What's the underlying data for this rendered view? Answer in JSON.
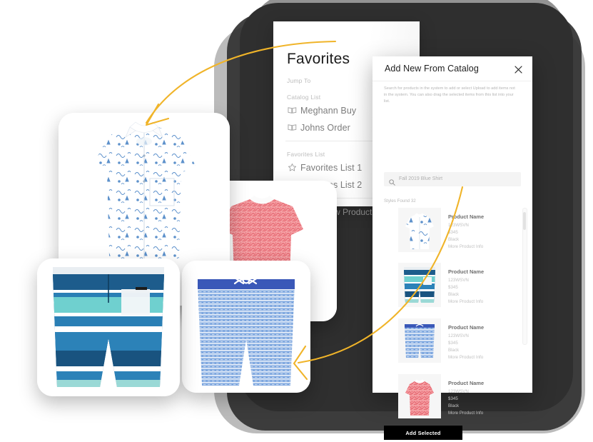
{
  "favorites_panel": {
    "title": "Favorites",
    "chevron_icon": "chevron-down-icon",
    "jump_to_label": "Jump To",
    "catalog_list_label": "Catalog List",
    "catalog_items": [
      {
        "label": "Meghann Buy",
        "icon": "book-icon"
      },
      {
        "label": "Johns Order",
        "icon": "book-icon"
      }
    ],
    "favorites_list_label": "Favorites List",
    "favorites_items": [
      {
        "label": "Favorites List 1",
        "icon": "star-icon"
      },
      {
        "label": "Favorites List 2",
        "icon": "star-icon"
      }
    ],
    "add_new_product_label": "Add New Product",
    "add_new_product_icon": "plus-icon"
  },
  "catalog_modal": {
    "title": "Add New From Catalog",
    "close_icon": "close-icon",
    "description": "Search for products in the system to add or select Upload to add items not in the system. You can also drag the selected items from this list into your list.",
    "search": {
      "icon": "search-icon",
      "placeholder": "Fall 2019 Blue Shirt",
      "value": ""
    },
    "styles_found_label": "Styles Found",
    "styles_found_count": "32",
    "products": [
      {
        "name": "Product Name",
        "sku": "123WSVN",
        "price": "$345",
        "color": "Black",
        "more_info": "More Product Info",
        "thumb": "blue-print-shirt"
      },
      {
        "name": "Product Name",
        "sku": "123WSVN",
        "price": "$345",
        "color": "Black",
        "more_info": "More Product Info",
        "thumb": "striped-swim-trunks"
      },
      {
        "name": "Product Name",
        "sku": "123WSVN",
        "price": "$345",
        "color": "Black",
        "more_info": "More Product Info",
        "thumb": "light-blue-board-shorts"
      },
      {
        "name": "Product Name",
        "sku": "123WSVN",
        "price": "$345",
        "color": "Black",
        "more_info": "More Product Info",
        "thumb": "red-print-shirt"
      }
    ],
    "add_selected_label": "Add Selected"
  },
  "photo_cards": [
    {
      "name": "blue-print-shirt-photo",
      "alt": "White short sleeve shirt with blue tropical print"
    },
    {
      "name": "red-print-shirt-photo",
      "alt": "Red and pink patterned short sleeve shirt"
    },
    {
      "name": "striped-swim-trunks-photo",
      "alt": "Blue and teal striped swim trunks with white pocket"
    },
    {
      "name": "light-blue-board-shorts-photo",
      "alt": "Light blue striped board shorts with navy waistband"
    }
  ],
  "colors": {
    "accent_arrow": "#f0b429",
    "backdrop_dark": "#333333",
    "button_primary": "#000000",
    "text_primary": "#1b1b1b",
    "text_muted": "#b5b5b5"
  }
}
